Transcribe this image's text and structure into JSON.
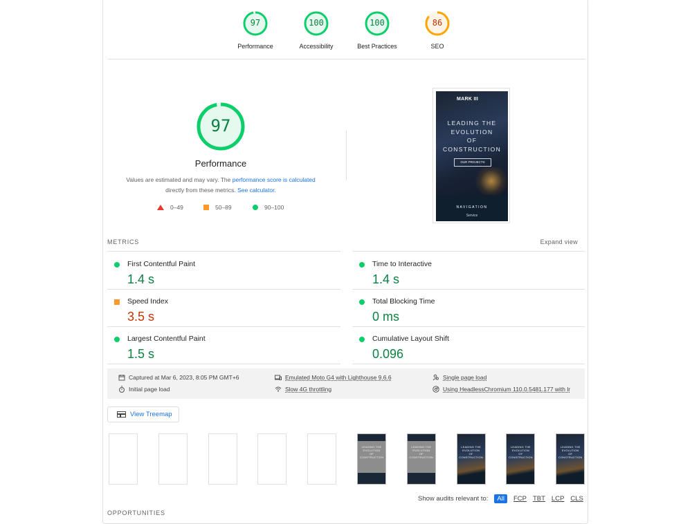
{
  "gauges": [
    {
      "score": "97",
      "label": "Performance",
      "color": "#0cce6b",
      "fraction": 0.97
    },
    {
      "score": "100",
      "label": "Accessibility",
      "color": "#0cce6b",
      "fraction": 1.0
    },
    {
      "score": "100",
      "label": "Best Practices",
      "color": "#0cce6b",
      "fraction": 1.0
    },
    {
      "score": "86",
      "label": "SEO",
      "color": "#ffa400",
      "fraction": 0.86
    }
  ],
  "performance": {
    "score": "97",
    "fraction": 0.97,
    "title": "Performance",
    "desc_prefix": "Values are estimated and may vary. The ",
    "desc_link1": "performance score is calculated",
    "desc_middle": "directly from these metrics. ",
    "desc_link2": "See calculator."
  },
  "legend": {
    "bad": "0–49",
    "average": "50–89",
    "good": "90–100"
  },
  "screenshot": {
    "logo": "MARK III",
    "hero_lines": [
      "LEADING THE",
      "EVOLUTION",
      "OF",
      "CONSTRUCTION"
    ],
    "button": "OUR PROJECTS",
    "nav_title": "NAVIGATION",
    "nav_item": "Service"
  },
  "metrics": {
    "heading": "METRICS",
    "expand": "Expand view",
    "items": [
      {
        "name": "First Contentful Paint",
        "value": "1.4 s",
        "status": "good"
      },
      {
        "name": "Time to Interactive",
        "value": "1.4 s",
        "status": "good"
      },
      {
        "name": "Speed Index",
        "value": "3.5 s",
        "status": "average"
      },
      {
        "name": "Total Blocking Time",
        "value": "0 ms",
        "status": "good"
      },
      {
        "name": "Largest Contentful Paint",
        "value": "1.5 s",
        "status": "good"
      },
      {
        "name": "Cumulative Layout Shift",
        "value": "0.096",
        "status": "good"
      }
    ]
  },
  "info": {
    "captured": "Captured at Mar 6, 2023, 8:05 PM GMT+6",
    "initial": "Initial page load",
    "device": "Emulated Moto G4 with Lighthouse 9.6.6",
    "throttling": "Slow 4G throttling",
    "single": "Single page load",
    "browser": "Using HeadlessChromium 110.0.5481.177 with lr"
  },
  "treemap": "View Treemap",
  "filmstrip": {
    "frames": [
      "blank",
      "blank",
      "blank",
      "blank",
      "blank",
      "grey",
      "grey",
      "dark",
      "dark",
      "dark"
    ],
    "grey_text": [
      "LEADING THE",
      "EVOLUTION",
      "OF CONSTRUCTION"
    ],
    "dark_text": [
      "LEADING THE",
      "EVOLUTION",
      "OF",
      "CONSTRUCTION"
    ]
  },
  "audits_filter": {
    "label": "Show audits relevant to:",
    "chips": [
      "All",
      "FCP",
      "TBT",
      "LCP",
      "CLS"
    ]
  },
  "opportunities": "OPPORTUNITIES",
  "colors": {
    "good": "#0cce6b",
    "average": "#ffa400",
    "good_text": "#0b8043",
    "average_text": "#c33300",
    "link": "#1a73e8"
  }
}
